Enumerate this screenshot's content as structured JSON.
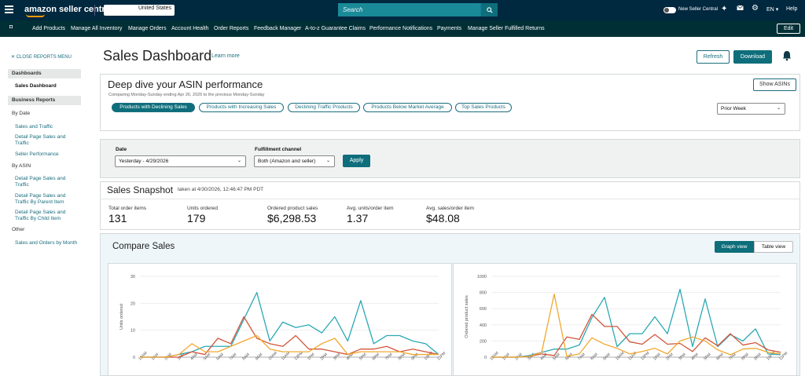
{
  "topbar": {
    "logo": "amazon seller central",
    "country": "United States",
    "search_placeholder": "Search",
    "toggle_label": "New Seller Central",
    "lang": "EN",
    "help": "Help"
  },
  "nav": {
    "items": [
      "Add Products",
      "Manage All Inventory",
      "Manage Orders",
      "Account Health",
      "Order Reports",
      "Feedback Manager",
      "A-to-z Guarantee Claims",
      "Performance Notifications",
      "Payments",
      "Manage Seller Fulfilled Returns"
    ],
    "edit": "Edit"
  },
  "sidebar": {
    "close": "CLOSE REPORTS MENU",
    "dashboards": "Dashboards",
    "sales_dashboard": "Sales Dashboard",
    "business_reports": "Business Reports",
    "by_date": "By Date",
    "by_date_links": [
      "Sales and Traffic",
      "Detail Page Sales and Traffic",
      "Seller Performance"
    ],
    "by_asin": "By ASIN",
    "by_asin_links": [
      "Detail Page Sales and Traffic",
      "Detail Page Sales and Traffic By Parent Item",
      "Detail Page Sales and Traffic By Child Item"
    ],
    "other": "Other",
    "other_links": [
      "Sales and Orders by Month"
    ]
  },
  "header": {
    "title": "Sales Dashboard",
    "learn_more": "Learn more",
    "refresh": "Refresh",
    "download": "Download"
  },
  "deep_dive": {
    "title": "Deep dive your ASIN performance",
    "subtitle": "Comparing Monday-Sunday ending Apr 26, 2026 to the previous Monday-Sunday",
    "pills": [
      "Products with Declining Sales",
      "Products with Increasing Sales",
      "Declining Traffic Products",
      "Products Below Market Average",
      "Top Sales Products"
    ],
    "show_asins": "Show ASINs",
    "period": "Prior Week"
  },
  "filters": {
    "date_label": "Date",
    "date_value": "Yesterday - 4/29/2026",
    "channel_label": "Fulfillment channel",
    "channel_value": "Both (Amazon and seller)",
    "apply": "Apply"
  },
  "snapshot": {
    "title": "Sales Snapshot",
    "taken": "taken at 4/30/2026, 12:46:47 PM PDT",
    "metrics": [
      {
        "label": "Total order items",
        "value": "131"
      },
      {
        "label": "Units ordered",
        "value": "179"
      },
      {
        "label": "Ordered product sales",
        "value": "$6,298.53"
      },
      {
        "label": "Avg. units/order item",
        "value": "1.37"
      },
      {
        "label": "Avg. sales/order item",
        "value": "$48.08"
      }
    ]
  },
  "compare": {
    "title": "Compare Sales",
    "graph_view": "Graph view",
    "table_view": "Table view"
  },
  "colors": {
    "teal": "#2aa8b4",
    "red": "#d2553a",
    "orange": "#f0a830"
  },
  "chart_data": [
    {
      "type": "line",
      "ylabel": "Units ordered",
      "ylim": [
        0,
        30
      ],
      "yticks": [
        0,
        10,
        20,
        30
      ],
      "categories": [
        "12AM",
        "1AM",
        "2AM",
        "3AM",
        "4AM",
        "5AM",
        "6AM",
        "7AM",
        "8AM",
        "9AM",
        "10AM",
        "11AM",
        "12PM",
        "1PM",
        "2PM",
        "3PM",
        "4PM",
        "5PM",
        "6PM",
        "7PM",
        "8PM",
        "9PM",
        "10PM",
        "11PM"
      ],
      "series": [
        {
          "values": [
            0,
            0,
            0,
            1,
            2,
            4,
            4,
            4,
            14,
            24,
            6,
            13,
            11,
            12,
            9,
            15,
            6,
            21,
            5,
            8,
            8,
            6,
            5,
            1
          ]
        },
        {
          "values": [
            0,
            0,
            0,
            0,
            2,
            1,
            7,
            5,
            15,
            7,
            5,
            4,
            8,
            3,
            3,
            2,
            1,
            3,
            3,
            4,
            2,
            3,
            2,
            1
          ]
        },
        {
          "values": [
            0,
            0,
            0,
            1,
            5,
            2,
            2,
            4,
            6,
            8,
            3,
            2,
            2,
            2,
            5,
            7,
            1,
            2,
            2,
            2,
            2,
            1,
            1,
            1
          ]
        }
      ]
    },
    {
      "type": "line",
      "ylabel": "Ordered product sales",
      "ylim": [
        0,
        1000
      ],
      "yticks": [
        0,
        200,
        400,
        600,
        800,
        1000
      ],
      "categories": [
        "12AM",
        "1AM",
        "2AM",
        "3AM",
        "4AM",
        "5AM",
        "6AM",
        "7AM",
        "8AM",
        "9AM",
        "10AM",
        "11AM",
        "12PM",
        "1PM",
        "2PM",
        "3PM",
        "4PM",
        "5PM",
        "6PM",
        "7PM",
        "8PM",
        "9PM",
        "10PM",
        "11PM"
      ],
      "series": [
        {
          "values": [
            0,
            0,
            0,
            20,
            60,
            100,
            100,
            150,
            490,
            740,
            130,
            290,
            290,
            500,
            290,
            840,
            130,
            720,
            130,
            280,
            200,
            350,
            40,
            30
          ]
        },
        {
          "values": [
            0,
            0,
            0,
            10,
            40,
            20,
            250,
            220,
            530,
            380,
            380,
            190,
            160,
            280,
            160,
            170,
            70,
            240,
            140,
            290,
            150,
            180,
            90,
            60
          ]
        },
        {
          "values": [
            0,
            0,
            0,
            10,
            60,
            780,
            10,
            40,
            240,
            160,
            110,
            40,
            70,
            110,
            40,
            200,
            250,
            200,
            90,
            30,
            100,
            110,
            60,
            40
          ]
        }
      ]
    }
  ]
}
